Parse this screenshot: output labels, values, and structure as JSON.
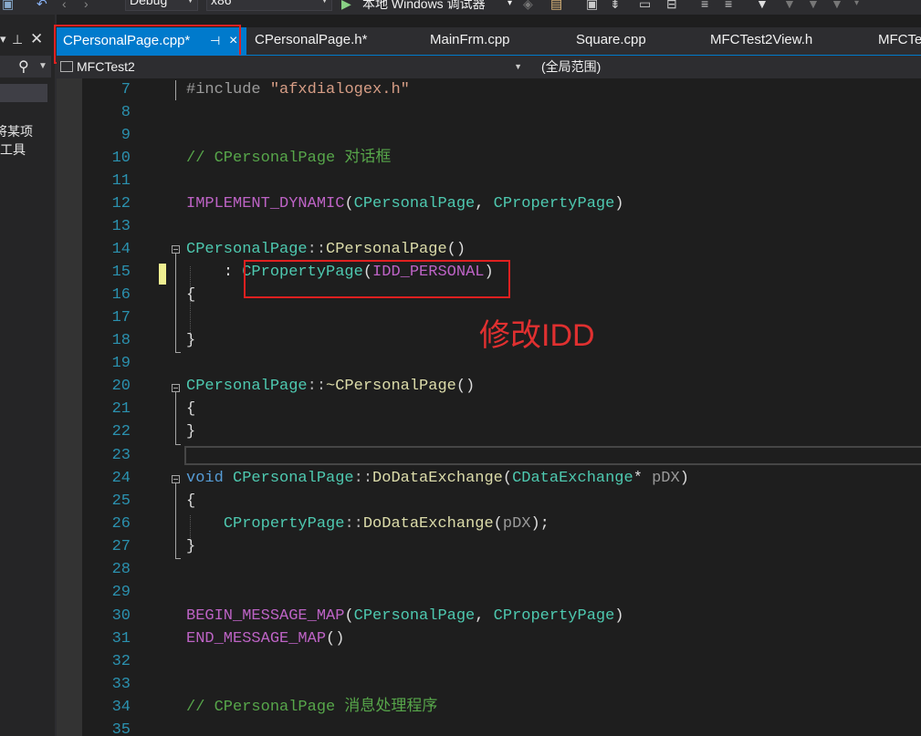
{
  "toolbar": {
    "config": "Debug",
    "platform": "x86",
    "run_label": "本地 Windows 调试器"
  },
  "left_panel": {
    "text1": "将某项",
    "text2": "工具",
    "search_icon": "search-icon"
  },
  "tabs": [
    {
      "label": "CPersonalPage.cpp*",
      "active": true
    },
    {
      "label": "CPersonalPage.h*"
    },
    {
      "label": "MainFrm.cpp"
    },
    {
      "label": "Square.cpp"
    },
    {
      "label": "MFCTest2View.h"
    },
    {
      "label": "MFCTe"
    }
  ],
  "nav": {
    "project": "MFCTest2",
    "scope": "(全局范围)"
  },
  "line_numbers": [
    "7",
    "8",
    "9",
    "10",
    "11",
    "12",
    "13",
    "14",
    "15",
    "16",
    "17",
    "18",
    "19",
    "20",
    "21",
    "22",
    "23",
    "24",
    "25",
    "26",
    "27",
    "28",
    "29",
    "30",
    "31",
    "32",
    "33",
    "34",
    "35"
  ],
  "code": {
    "l7_dir": "#include",
    "l7_str": "\"afxdialogex.h\"",
    "l10": "// CPersonalPage 对话框",
    "l12_mac": "IMPLEMENT_DYNAMIC",
    "l12_open": "(",
    "l12_a": "CPersonalPage",
    "l12_sep": ", ",
    "l12_b": "CPropertyPage",
    "l12_close": ")",
    "l14_cls": "CPersonalPage",
    "l14_op": "::",
    "l14_fn": "CPersonalPage",
    "l14_paren": "()",
    "l15_colon": ": ",
    "l15_cls": "CPropertyPage",
    "l15_open": "(",
    "l15_arg": "IDD_PERSONAL",
    "l15_close": ")",
    "brace_open": "{",
    "brace_close": "}",
    "l20_cls": "CPersonalPage",
    "l20_op": "::",
    "l20_fn": "~CPersonalPage",
    "l20_paren": "()",
    "l24_kw": "void",
    "l24_cls": "CPersonalPage",
    "l24_op": "::",
    "l24_fn": "DoDataExchange",
    "l24_open": "(",
    "l24_type": "CDataExchange",
    "l24_star": "* ",
    "l24_param": "pDX",
    "l24_close": ")",
    "l26_cls": "CPropertyPage",
    "l26_op": "::",
    "l26_fn": "DoDataExchange",
    "l26_open": "(",
    "l26_arg": "pDX",
    "l26_close": ");",
    "l30_mac": "BEGIN_MESSAGE_MAP",
    "l30_open": "(",
    "l30_a": "CPersonalPage",
    "l30_sep": ", ",
    "l30_b": "CPropertyPage",
    "l30_close": ")",
    "l31_mac": "END_MESSAGE_MAP",
    "l31_paren": "()",
    "l34": "// CPersonalPage 消息处理程序"
  },
  "annotation": "修改IDD",
  "colors": {
    "accent": "#007acc",
    "highlight_red": "#e02020",
    "comment": "#57a64a",
    "class": "#4ec9b0",
    "function": "#dcdcaa",
    "keyword": "#569cd6",
    "macro": "#bd63c5"
  }
}
